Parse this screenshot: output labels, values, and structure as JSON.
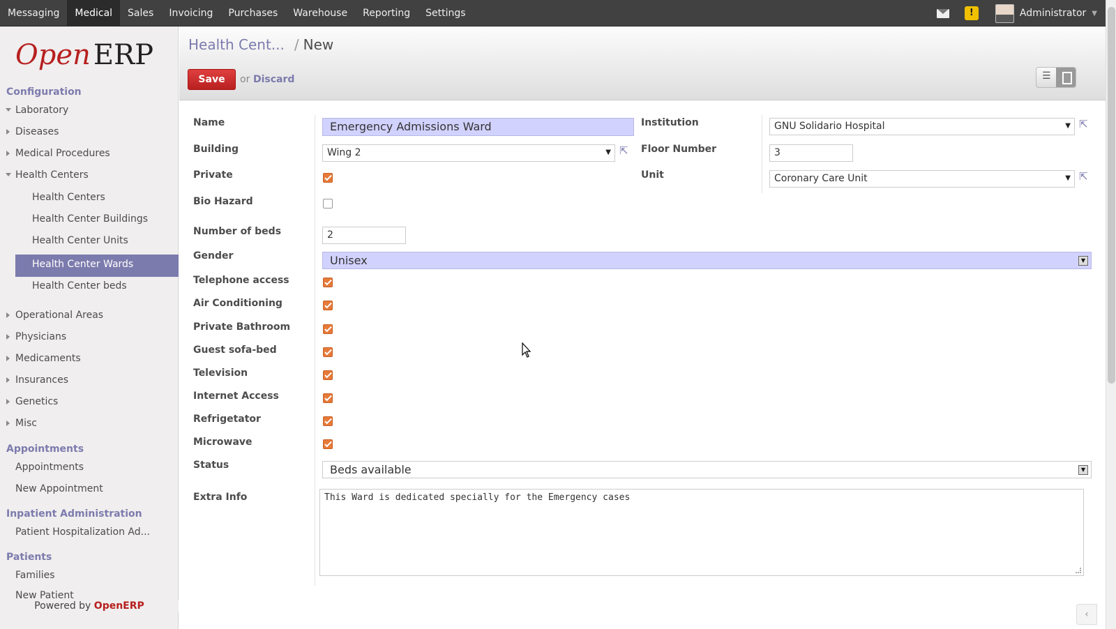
{
  "top_menu": [
    "Messaging",
    "Medical",
    "Sales",
    "Invoicing",
    "Purchases",
    "Warehouse",
    "Reporting",
    "Settings"
  ],
  "active_menu": "Medical",
  "user": {
    "name": "Administrator",
    "warning": "!"
  },
  "logo": {
    "open": "Open",
    "erp": "ERP"
  },
  "sidebar": {
    "configuration": "Configuration",
    "laboratory": "Laboratory",
    "diseases": "Diseases",
    "medical_procedures": "Medical Procedures",
    "health_centers": "Health Centers",
    "sub_health_centers": "Health Centers",
    "sub_buildings": "Health Center Buildings",
    "sub_units": "Health Center Units",
    "sub_wards": "Health Center Wards",
    "sub_beds": "Health Center beds",
    "operational_areas": "Operational Areas",
    "physicians": "Physicians",
    "medicaments": "Medicaments",
    "insurances": "Insurances",
    "genetics": "Genetics",
    "misc": "Misc",
    "appointments_title": "Appointments",
    "appointments": "Appointments",
    "new_appointment": "New Appointment",
    "inpatient_title": "Inpatient Administration",
    "patient_hosp": "Patient Hospitalization Ad...",
    "patients_title": "Patients",
    "families": "Families",
    "new_patient": "New Patient",
    "powered_prefix": "Powered by ",
    "powered_brand": "OpenERP"
  },
  "breadcrumb": {
    "parent": "Health Cent...",
    "sep": "/",
    "current": "New"
  },
  "actions": {
    "save": "Save",
    "or": "or",
    "discard": "Discard"
  },
  "form": {
    "labels": {
      "name": "Name",
      "institution": "Institution",
      "building": "Building",
      "floor": "Floor Number",
      "private": "Private",
      "unit": "Unit",
      "bio_hazard": "Bio Hazard",
      "beds": "Number of beds",
      "gender": "Gender",
      "telephone": "Telephone access",
      "ac": "Air Conditioning",
      "bathroom": "Private Bathroom",
      "sofa": "Guest sofa-bed",
      "tv": "Television",
      "internet": "Internet Access",
      "fridge": "Refrigetator",
      "microwave": "Microwave",
      "status": "Status",
      "extra": "Extra Info"
    },
    "values": {
      "name": "Emergency Admissions Ward",
      "institution": "GNU Solidario Hospital",
      "building": "Wing 2",
      "floor": "3",
      "unit": "Coronary Care Unit",
      "beds": "2",
      "gender": "Unisex",
      "status": "Beds available",
      "extra": "This Ward is dedicated specially for the Emergency cases"
    },
    "checks": {
      "private": true,
      "bio_hazard": false,
      "telephone": true,
      "ac": true,
      "bathroom": true,
      "sofa": true,
      "tv": true,
      "internet": true,
      "fridge": true,
      "microwave": true
    }
  },
  "colors": {
    "accent": "#7c7bad",
    "brand_red": "#b71f1f",
    "checkbox": "#e67a3a",
    "required_bg": "#d2d2ff"
  }
}
